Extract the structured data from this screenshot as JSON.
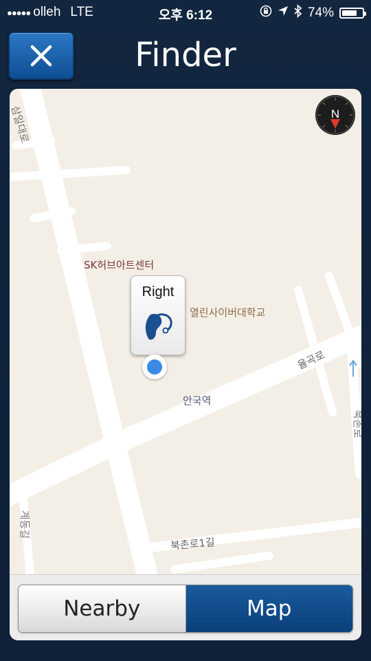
{
  "status_bar": {
    "signal_dots": "●●●●●",
    "carrier": "olleh",
    "network": "LTE",
    "time": "오후 6:12",
    "battery_percent": "74%",
    "battery_level": 0.74
  },
  "navbar": {
    "title": "Finder",
    "close_icon": "close-icon"
  },
  "map": {
    "compass_letter": "N",
    "pin": {
      "label": "Right",
      "icon": "hearing-aid-icon"
    },
    "labels": {
      "road_top_left": "삼일대로",
      "landmark_sk": "SK허브아트센터",
      "landmark_university": "열린사이버대학교",
      "road_yulgok": "율곡로",
      "station": "안국역",
      "road_gyedong": "계동길",
      "road_bukchon": "북촌로1길",
      "road_right_edge": "북촌로"
    }
  },
  "segmented_control": {
    "nearby_label": "Nearby",
    "map_label": "Map",
    "selected": "Map"
  },
  "colors": {
    "accent": "#0e4e93",
    "map_background": "#f4efe6",
    "road": "#ffffff",
    "location_dot": "#3a8ae6"
  }
}
